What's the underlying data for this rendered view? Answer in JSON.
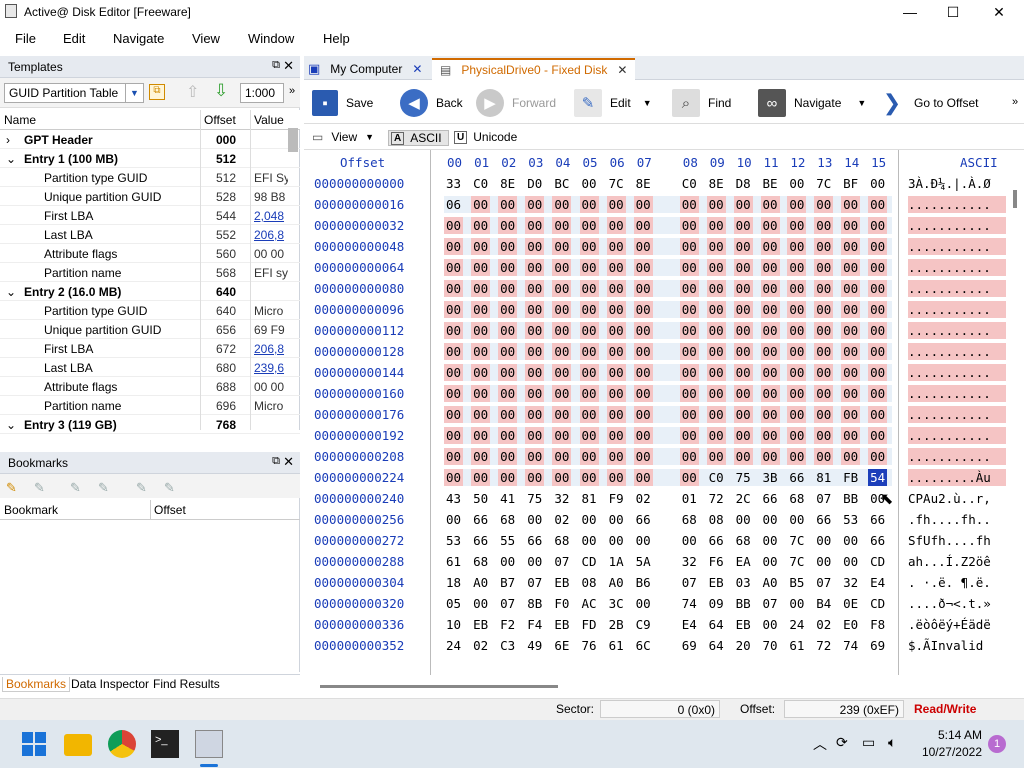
{
  "window": {
    "title": "Active@ Disk Editor [Freeware]"
  },
  "menu": [
    "File",
    "Edit",
    "Navigate",
    "View",
    "Window",
    "Help"
  ],
  "templates_pane": {
    "title": "Templates",
    "template_select": "GUID Partition Table",
    "zoom": "1:000",
    "columns": [
      "Name",
      "Offset",
      "Value"
    ],
    "rows": [
      {
        "name": "GPT Header",
        "offset": "000",
        "value": "",
        "level": 0,
        "bold": true,
        "expander": "›"
      },
      {
        "name": "Entry 1 (100 MB)",
        "offset": "512",
        "value": "",
        "level": 0,
        "bold": true,
        "expander": "⌄"
      },
      {
        "name": "Partition type GUID",
        "offset": "512",
        "value": "EFI Sy",
        "level": 1
      },
      {
        "name": "Unique partition GUID",
        "offset": "528",
        "value": "98 B8",
        "level": 1
      },
      {
        "name": "First LBA",
        "offset": "544",
        "value": "2,048",
        "level": 1,
        "link": true
      },
      {
        "name": "Last LBA",
        "offset": "552",
        "value": "206,8",
        "level": 1,
        "link": true
      },
      {
        "name": "Attribute flags",
        "offset": "560",
        "value": "00 00",
        "level": 1
      },
      {
        "name": "Partition name",
        "offset": "568",
        "value": "EFI sy",
        "level": 1
      },
      {
        "name": "Entry 2 (16.0 MB)",
        "offset": "640",
        "value": "",
        "level": 0,
        "bold": true,
        "expander": "⌄"
      },
      {
        "name": "Partition type GUID",
        "offset": "640",
        "value": "Micro",
        "level": 1
      },
      {
        "name": "Unique partition GUID",
        "offset": "656",
        "value": "69 F9",
        "level": 1
      },
      {
        "name": "First LBA",
        "offset": "672",
        "value": "206,8",
        "level": 1,
        "link": true
      },
      {
        "name": "Last LBA",
        "offset": "680",
        "value": "239,6",
        "level": 1,
        "link": true
      },
      {
        "name": "Attribute flags",
        "offset": "688",
        "value": "00 00",
        "level": 1
      },
      {
        "name": "Partition name",
        "offset": "696",
        "value": "Micro",
        "level": 1
      },
      {
        "name": "Entry 3 (119 GB)",
        "offset": "768",
        "value": "",
        "level": 0,
        "bold": true,
        "expander": "⌄"
      }
    ]
  },
  "bookmarks_pane": {
    "title": "Bookmarks",
    "columns": [
      "Bookmark",
      "Offset"
    ]
  },
  "bottom_tabs": [
    "Bookmarks",
    "Data Inspector",
    "Find Results"
  ],
  "doc_tabs": [
    {
      "label": "My Computer",
      "active": false
    },
    {
      "label": "PhysicalDrive0 - Fixed Disk",
      "active": true
    }
  ],
  "toolbar": {
    "save": "Save",
    "back": "Back",
    "forward": "Forward",
    "edit": "Edit",
    "find": "Find",
    "navigate": "Navigate",
    "goto": "Go to Offset"
  },
  "view_toolbar": {
    "view": "View",
    "ascii": "ASCII",
    "unicode": "Unicode"
  },
  "hex": {
    "offset_header": "Offset",
    "ascii_header": "ASCII",
    "columns": [
      "00",
      "01",
      "02",
      "03",
      "04",
      "05",
      "06",
      "07",
      "08",
      "09",
      "10",
      "11",
      "12",
      "13",
      "14",
      "15"
    ],
    "rows": [
      {
        "offset": "000000000000",
        "bytes": [
          "33",
          "C0",
          "8E",
          "D0",
          "BC",
          "00",
          "7C",
          "8E",
          "C0",
          "8E",
          "D8",
          "BE",
          "00",
          "7C",
          "BF",
          "00"
        ],
        "ascii": "3À.Ð¼.|.À.Ø"
      },
      {
        "offset": "000000000016",
        "bytes": [
          "06",
          "00",
          "00",
          "00",
          "00",
          "00",
          "00",
          "00",
          "00",
          "00",
          "00",
          "00",
          "00",
          "00",
          "00",
          "00"
        ],
        "ascii": "..........."
      },
      {
        "offset": "000000000032",
        "bytes": [
          "00",
          "00",
          "00",
          "00",
          "00",
          "00",
          "00",
          "00",
          "00",
          "00",
          "00",
          "00",
          "00",
          "00",
          "00",
          "00"
        ],
        "ascii": "..........."
      },
      {
        "offset": "000000000048",
        "bytes": [
          "00",
          "00",
          "00",
          "00",
          "00",
          "00",
          "00",
          "00",
          "00",
          "00",
          "00",
          "00",
          "00",
          "00",
          "00",
          "00"
        ],
        "ascii": "..........."
      },
      {
        "offset": "000000000064",
        "bytes": [
          "00",
          "00",
          "00",
          "00",
          "00",
          "00",
          "00",
          "00",
          "00",
          "00",
          "00",
          "00",
          "00",
          "00",
          "00",
          "00"
        ],
        "ascii": "..........."
      },
      {
        "offset": "000000000080",
        "bytes": [
          "00",
          "00",
          "00",
          "00",
          "00",
          "00",
          "00",
          "00",
          "00",
          "00",
          "00",
          "00",
          "00",
          "00",
          "00",
          "00"
        ],
        "ascii": "..........."
      },
      {
        "offset": "000000000096",
        "bytes": [
          "00",
          "00",
          "00",
          "00",
          "00",
          "00",
          "00",
          "00",
          "00",
          "00",
          "00",
          "00",
          "00",
          "00",
          "00",
          "00"
        ],
        "ascii": "..........."
      },
      {
        "offset": "000000000112",
        "bytes": [
          "00",
          "00",
          "00",
          "00",
          "00",
          "00",
          "00",
          "00",
          "00",
          "00",
          "00",
          "00",
          "00",
          "00",
          "00",
          "00"
        ],
        "ascii": "..........."
      },
      {
        "offset": "000000000128",
        "bytes": [
          "00",
          "00",
          "00",
          "00",
          "00",
          "00",
          "00",
          "00",
          "00",
          "00",
          "00",
          "00",
          "00",
          "00",
          "00",
          "00"
        ],
        "ascii": "..........."
      },
      {
        "offset": "000000000144",
        "bytes": [
          "00",
          "00",
          "00",
          "00",
          "00",
          "00",
          "00",
          "00",
          "00",
          "00",
          "00",
          "00",
          "00",
          "00",
          "00",
          "00"
        ],
        "ascii": "..........."
      },
      {
        "offset": "000000000160",
        "bytes": [
          "00",
          "00",
          "00",
          "00",
          "00",
          "00",
          "00",
          "00",
          "00",
          "00",
          "00",
          "00",
          "00",
          "00",
          "00",
          "00"
        ],
        "ascii": "..........."
      },
      {
        "offset": "000000000176",
        "bytes": [
          "00",
          "00",
          "00",
          "00",
          "00",
          "00",
          "00",
          "00",
          "00",
          "00",
          "00",
          "00",
          "00",
          "00",
          "00",
          "00"
        ],
        "ascii": "..........."
      },
      {
        "offset": "000000000192",
        "bytes": [
          "00",
          "00",
          "00",
          "00",
          "00",
          "00",
          "00",
          "00",
          "00",
          "00",
          "00",
          "00",
          "00",
          "00",
          "00",
          "00"
        ],
        "ascii": "..........."
      },
      {
        "offset": "000000000208",
        "bytes": [
          "00",
          "00",
          "00",
          "00",
          "00",
          "00",
          "00",
          "00",
          "00",
          "00",
          "00",
          "00",
          "00",
          "00",
          "00",
          "00"
        ],
        "ascii": "..........."
      },
      {
        "offset": "000000000224",
        "bytes": [
          "00",
          "00",
          "00",
          "00",
          "00",
          "00",
          "00",
          "00",
          "00",
          "C0",
          "75",
          "3B",
          "66",
          "81",
          "FB",
          "54"
        ],
        "ascii": ".........Àu"
      },
      {
        "offset": "000000000240",
        "bytes": [
          "43",
          "50",
          "41",
          "75",
          "32",
          "81",
          "F9",
          "02",
          "01",
          "72",
          "2C",
          "66",
          "68",
          "07",
          "BB",
          "00"
        ],
        "ascii": "CPAu2.ù..r,"
      },
      {
        "offset": "000000000256",
        "bytes": [
          "00",
          "66",
          "68",
          "00",
          "02",
          "00",
          "00",
          "66",
          "68",
          "08",
          "00",
          "00",
          "00",
          "66",
          "53",
          "66"
        ],
        "ascii": ".fh....fh.."
      },
      {
        "offset": "000000000272",
        "bytes": [
          "53",
          "66",
          "55",
          "66",
          "68",
          "00",
          "00",
          "00",
          "00",
          "66",
          "68",
          "00",
          "7C",
          "00",
          "00",
          "66"
        ],
        "ascii": "SfUfh....fh"
      },
      {
        "offset": "000000000288",
        "bytes": [
          "61",
          "68",
          "00",
          "00",
          "07",
          "CD",
          "1A",
          "5A",
          "32",
          "F6",
          "EA",
          "00",
          "7C",
          "00",
          "00",
          "CD"
        ],
        "ascii": "ah...Í.Z2öê"
      },
      {
        "offset": "000000000304",
        "bytes": [
          "18",
          "A0",
          "B7",
          "07",
          "EB",
          "08",
          "A0",
          "B6",
          "07",
          "EB",
          "03",
          "A0",
          "B5",
          "07",
          "32",
          "E4"
        ],
        "ascii": ". ·.ë. ¶.ë."
      },
      {
        "offset": "000000000320",
        "bytes": [
          "05",
          "00",
          "07",
          "8B",
          "F0",
          "AC",
          "3C",
          "00",
          "74",
          "09",
          "BB",
          "07",
          "00",
          "B4",
          "0E",
          "CD"
        ],
        "ascii": "....ð¬<.t.»"
      },
      {
        "offset": "000000000336",
        "bytes": [
          "10",
          "EB",
          "F2",
          "F4",
          "EB",
          "FD",
          "2B",
          "C9",
          "E4",
          "64",
          "EB",
          "00",
          "24",
          "02",
          "E0",
          "F8"
        ],
        "ascii": ".ëòôëý+Éädë"
      },
      {
        "offset": "000000000352",
        "bytes": [
          "24",
          "02",
          "C3",
          "49",
          "6E",
          "76",
          "61",
          "6C",
          "69",
          "64",
          "20",
          "70",
          "61",
          "72",
          "74",
          "69"
        ],
        "ascii": "$.ÃInvalid"
      }
    ]
  },
  "status": {
    "sector_label": "Sector:",
    "sector_value": "0 (0x0)",
    "offset_label": "Offset:",
    "offset_value": "239 (0xEF)",
    "mode": "Read/Write"
  },
  "taskbar": {
    "time": "5:14 AM",
    "date": "10/27/2022",
    "badge": "1"
  },
  "colors": {
    "zero_highlight": "#f5c4c4",
    "offset_blue": "#1a3db8",
    "selection": "#1c3fba",
    "readwrite": "#cc0000"
  }
}
